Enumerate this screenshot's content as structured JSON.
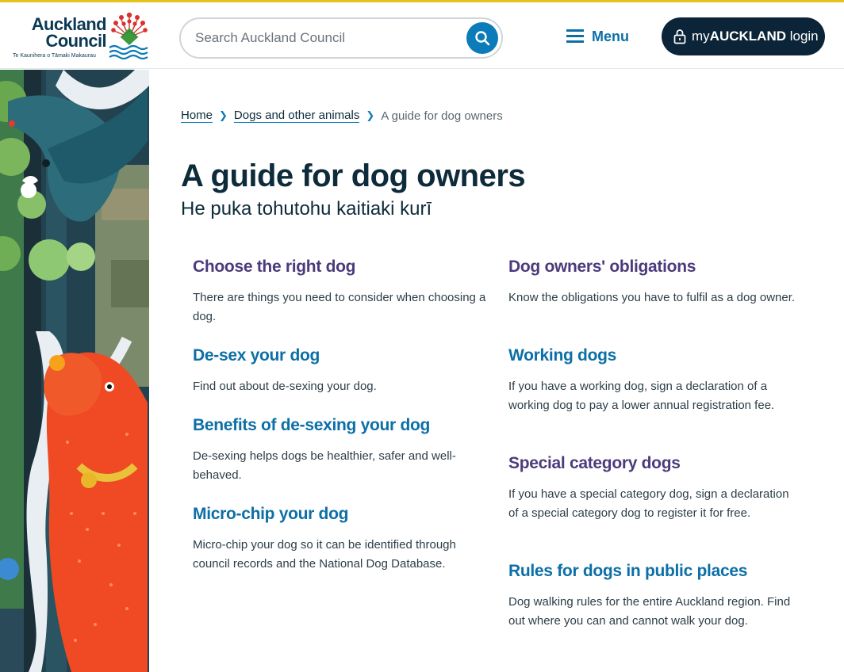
{
  "header": {
    "logo": {
      "line1": "Auckland",
      "line2": "Council",
      "tagline": "Te Kaunihera o Tāmaki Makaurau"
    },
    "search": {
      "placeholder": "Search Auckland Council"
    },
    "menu_label": "Menu",
    "login": {
      "prefix": "my",
      "brand": "AUCKLAND",
      "suffix": " login"
    }
  },
  "breadcrumb": {
    "home": "Home",
    "parent": "Dogs and other animals",
    "current": "A guide for dog owners"
  },
  "page": {
    "title": "A guide for dog owners",
    "subtitle": "He puka tohutohu kaitiaki kurī"
  },
  "cards": [
    {
      "title": "Choose the right dog",
      "text": "There are things you need to consider when choosing a dog."
    },
    {
      "title": "De-sex your dog",
      "text": "Find out about de-sexing your dog."
    },
    {
      "title": "Benefits of de-sexing your dog",
      "text": "De-sexing helps dogs be healthier, safer and well-behaved."
    },
    {
      "title": "Micro-chip your dog",
      "text": "Micro-chip your dog so it can be identified through council records and the National Dog Database."
    },
    {
      "title": "Dog owners' obligations",
      "text": "Know the obligations you have to fulfil as a dog owner."
    },
    {
      "title": "Working dogs",
      "text": "If you have a working dog, sign a declaration of a working dog to pay a lower annual registration fee."
    },
    {
      "title": "Special category dogs",
      "text": "If you have a special category dog, sign a declaration of a special category dog to register it for free."
    },
    {
      "title": "Rules for dogs in public places",
      "text": "Dog walking rules for the entire Auckland region. Find out where you can and cannot walk your dog."
    }
  ],
  "colors": {
    "brand_navy": "#0b2438",
    "link_blue": "#0c6fa6",
    "visited_purple": "#4b3b7c",
    "accent_yellow": "#e7c21d"
  },
  "icons": {
    "search": "search-icon",
    "menu": "hamburger-icon",
    "login": "lock-icon",
    "breadcrumb_separator": "chevron-right-icon"
  }
}
